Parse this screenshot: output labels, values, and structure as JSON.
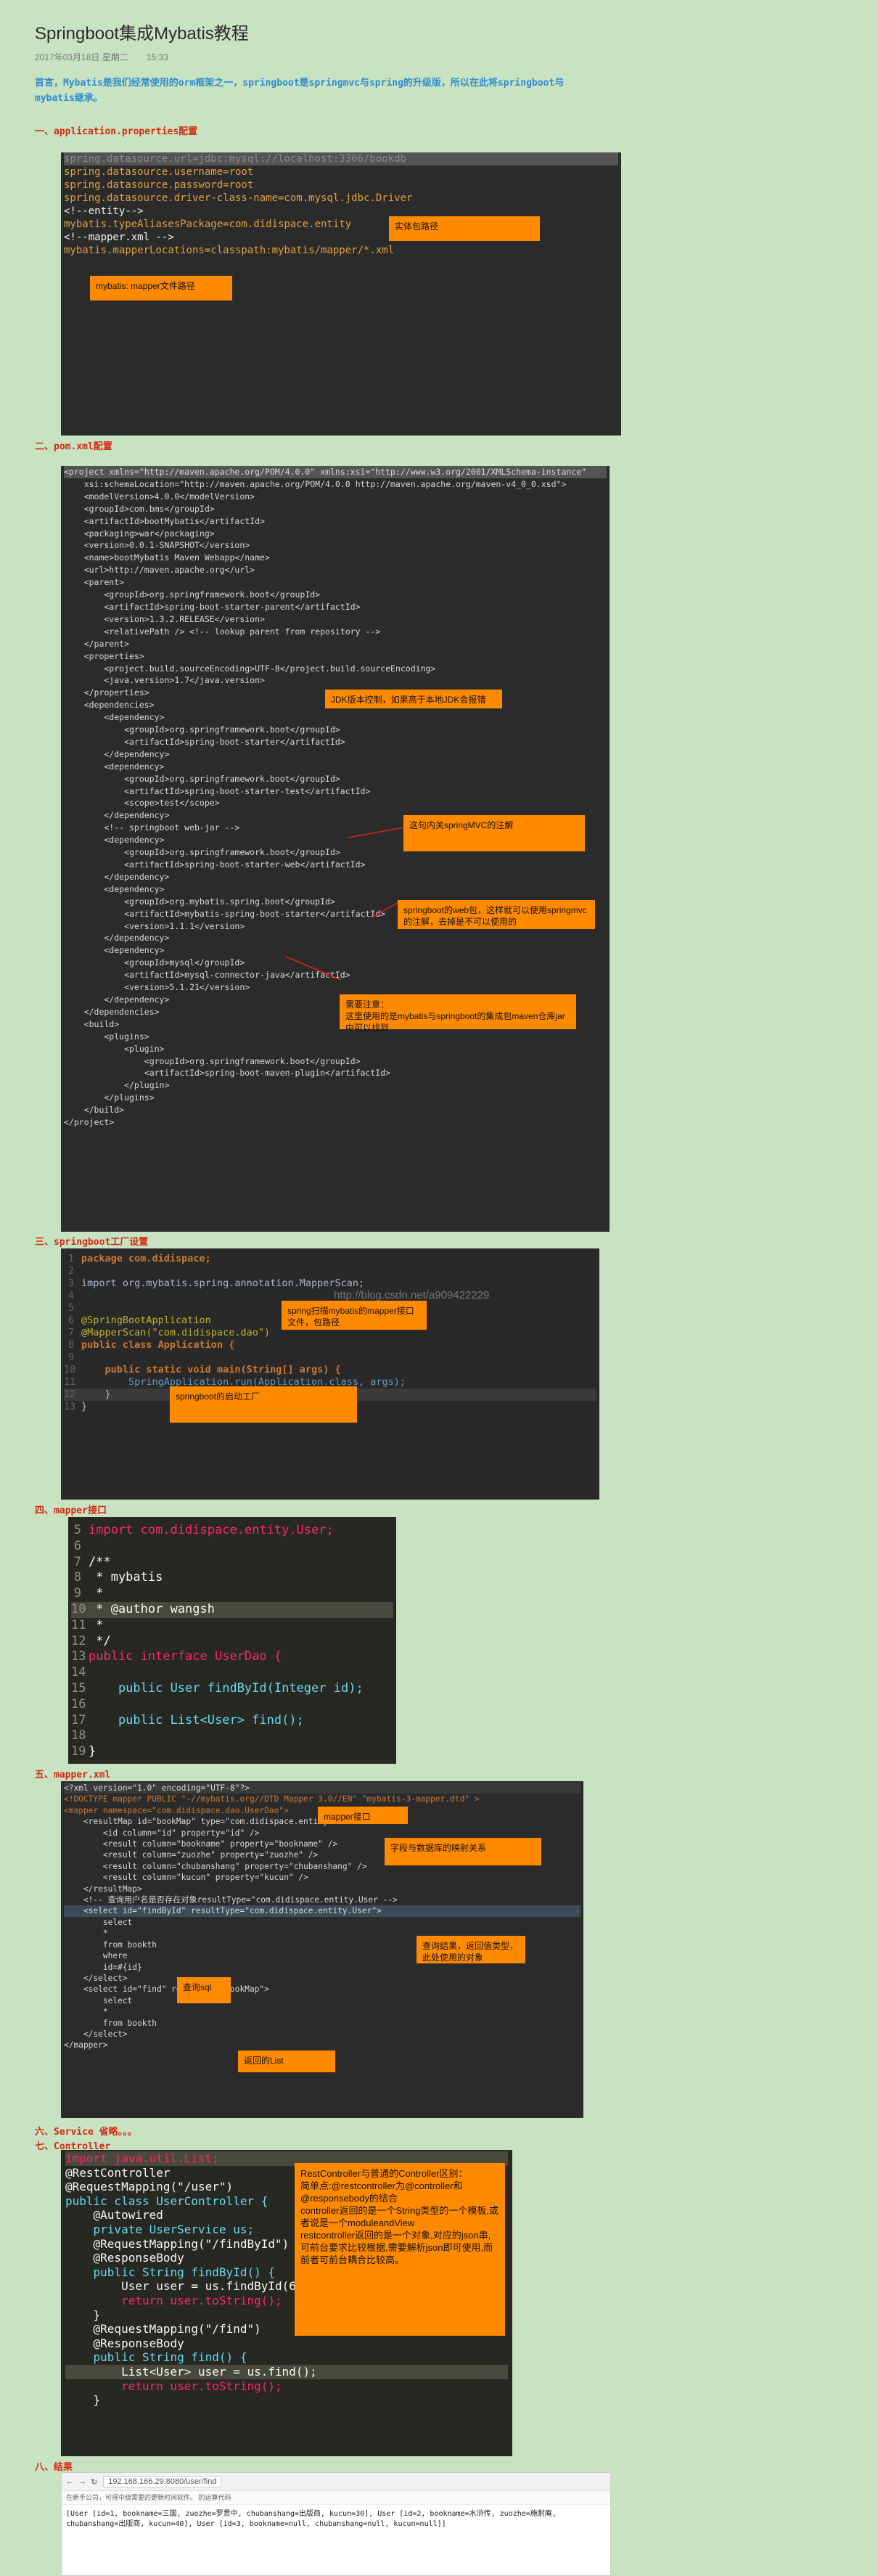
{
  "header": {
    "title": "Springboot集成Mybatis教程",
    "date": "2017年03月18日 星期二",
    "time": "15:33",
    "intro": "首言，Mybatis是我们经常使用的orm框架之一，springboot是springmvc与spring的升级版，所以在此将springboot与mybatis继承。"
  },
  "sections": {
    "s1": "一、application.properties配置",
    "s2": "二、pom.xml配置",
    "s3": "三、springboot工厂设置",
    "s4": "四、mapper接口",
    "s5": "五、mapper.xml",
    "s6": "六、Service 省略。。。",
    "s7": "七、Controller",
    "s8": "八、结果"
  },
  "props": {
    "lines": [
      "spring.datasource.url=jdbc:mysql://localhost:3306/bookdb",
      "spring.datasource.username=root",
      "spring.datasource.password=root",
      "spring.datasource.driver-class-name=com.mysql.jdbc.Driver",
      "<!--entity-->",
      "mybatis.typeAliasesPackage=com.didispace.entity",
      "<!--mapper.xml -->",
      "mybatis.mapperLocations=classpath:mybatis/mapper/*.xml"
    ],
    "note_entity": "实体包路径",
    "note_mapper": "mybatis: mapper文件路径"
  },
  "pom": {
    "lines": [
      "<project xmlns=\"http://maven.apache.org/POM/4.0.0\" xmlns:xsi=\"http://www.w3.org/2001/XMLSchema-instance\"",
      "    xsi:schemaLocation=\"http://maven.apache.org/POM/4.0.0 http://maven.apache.org/maven-v4_0_0.xsd\">",
      "    <modelVersion>4.0.0</modelVersion>",
      "    <groupId>com.bms</groupId>",
      "    <artifactId>bootMybatis</artifactId>",
      "    <packaging>war</packaging>",
      "    <version>0.0.1-SNAPSHOT</version>",
      "    <name>bootMybatis Maven Webapp</name>",
      "    <url>http://maven.apache.org</url>",
      "    <parent>",
      "        <groupId>org.springframework.boot</groupId>",
      "        <artifactId>spring-boot-starter-parent</artifactId>",
      "        <version>1.3.2.RELEASE</version>",
      "        <relativePath /> <!-- lookup parent from repository -->",
      "    </parent>",
      "",
      "    <properties>",
      "        <project.build.sourceEncoding>UTF-8</project.build.sourceEncoding>",
      "        <java.version>1.7</java.version>",
      "    </properties>",
      "",
      "    <dependencies>",
      "",
      "        <dependency>",
      "            <groupId>org.springframework.boot</groupId>",
      "            <artifactId>spring-boot-starter</artifactId>",
      "        </dependency>",
      "",
      "        <dependency>",
      "            <groupId>org.springframework.boot</groupId>",
      "            <artifactId>spring-boot-starter-test</artifactId>",
      "            <scope>test</scope>",
      "        </dependency>",
      "",
      "        <!-- springboot web-jar -->",
      "        <dependency>",
      "            <groupId>org.springframework.boot</groupId>",
      "            <artifactId>spring-boot-starter-web</artifactId>",
      "        </dependency>",
      "",
      "        <dependency>",
      "            <groupId>org.mybatis.spring.boot</groupId>",
      "            <artifactId>mybatis-spring-boot-starter</artifactId>",
      "            <version>1.1.1</version>",
      "        </dependency>",
      "        <dependency>",
      "            <groupId>mysql</groupId>",
      "            <artifactId>mysql-connector-java</artifactId>",
      "            <version>5.1.21</version>",
      "        </dependency>",
      "",
      "    </dependencies>",
      "",
      "    <build>",
      "        <plugins>",
      "            <plugin>",
      "                <groupId>org.springframework.boot</groupId>",
      "                <artifactId>spring-boot-maven-plugin</artifactId>",
      "            </plugin>",
      "        </plugins>",
      "    </build>",
      "</project>"
    ],
    "note_jdk": "JDK版本控制，如果高于本地JDK会报错",
    "note_test": "这句内关springMVC的注解",
    "note_web": "springboot的web包，这样就可以使用springmvc的注解，去掉是不可以使用的",
    "note_mybatis": "需要注意：\n这里使用的是mybatis与springboot的集成包maven仓库jar中可以找到"
  },
  "app": {
    "lines": [
      "package com.didispace;",
      "",
      "import org.mybatis.spring.annotation.MapperScan;",
      "",
      "@SpringBootApplication",
      "@MapperScan(\"com.didispace.dao\")",
      "public class Application {",
      "",
      "    public static void main(String[] args) {",
      "        SpringApplication.run(Application.class, args);",
      "    }",
      "}"
    ],
    "line_numbers": [
      "1",
      "2",
      "3",
      "4",
      "5",
      "6",
      "7",
      "8",
      "9",
      "10",
      "11",
      "12",
      "13"
    ],
    "watermark": "http://blog.csdn.net/a909422229",
    "note_scan": "spring扫描mybatis的mapper接口文件，包路径",
    "note_factory": "springboot的启动工厂"
  },
  "dao": {
    "line_numbers": [
      "5",
      "6",
      "7",
      "8",
      "9",
      "10",
      "11",
      "12",
      "13",
      "14",
      "15",
      "16",
      "17",
      "18",
      "19"
    ],
    "lines": [
      "import com.didispace.entity.User;",
      "",
      "/**",
      " * mybatis",
      " *",
      " * @author wangsh",
      " *",
      " */",
      "public interface UserDao {",
      "",
      "    public User findById(Integer id);",
      "",
      "    public List<User> find();",
      "",
      "}"
    ]
  },
  "mapperxml": {
    "lines": [
      "<?xml version=\"1.0\" encoding=\"UTF-8\"?>",
      "<!DOCTYPE mapper PUBLIC \"-//mybatis.org//DTD Mapper 3.0//EN\" \"mybatis-3-mapper.dtd\" >",
      "<mapper namespace=\"com.didispace.dao.UserDao\">",
      "",
      "    <resultMap id=\"bookMap\" type=\"com.didispace.entity.User\">",
      "        <id column=\"id\" property=\"id\" />",
      "        <result column=\"bookname\" property=\"bookname\" />",
      "        <result column=\"zuozhe\" property=\"zuozhe\" />",
      "        <result column=\"chubanshang\" property=\"chubanshang\" />",
      "        <result column=\"kucun\" property=\"kucun\" />",
      "    </resultMap>",
      "",
      "    <!-- 查询用户名是否存在对象resultType=\"com.didispace.entity.User -->",
      "",
      "    <select id=\"findById\" resultType=\"com.didispace.entity.User\">",
      "        select",
      "        *",
      "        from bookth",
      "        where",
      "        id=#{id}",
      "    </select>",
      "",
      "    <select id=\"find\" resultMap=\"bookMap\">",
      "        select",
      "        *",
      "        from bookth",
      "    </select>",
      "",
      "</mapper>"
    ],
    "note_iface": "mapper接口",
    "note_fields": "字段与数据库的映射关系",
    "note_result": "查询结果，返回值类型，此处使用的对象",
    "note_sql": "查询sql",
    "note_list": "返回的List"
  },
  "controller": {
    "lines": [
      "import java.util.List;",
      "",
      "@RestController",
      "@RequestMapping(\"/user\")",
      "public class UserController {",
      "    @Autowired",
      "    private UserService us;",
      "",
      "    @RequestMapping(\"/findById\")",
      "    @ResponseBody",
      "    public String findById() {",
      "        User user = us.findById(6);",
      "        return user.toString();",
      "    }",
      "",
      "    @RequestMapping(\"/find\")",
      "    @ResponseBody",
      "    public String find() {",
      "        List<User> user = us.find();",
      "        return user.toString();",
      "    }"
    ],
    "note": "RestController与普通的Controller区别：\n简单点:@restcontroller为@controller和@responsebody的结合\ncontroller返回的是一个String类型的一个模板,或者说是一个moduleandView\nrestcontroller返回的是一个对象,对应的json串,可前台要求比较根据,需要解析json即可使用,而前者可前台耦合比较高。"
  },
  "result": {
    "url": "192.168.166.29:8080/user/find",
    "bookmarks": "在新手公司，可得中级需要的更新时间软件。 的运算代码",
    "output": "[User [id=1, bookname=三国, zuozhe=罗贯中, chubanshang=出版商, kucun=30], User [id=2, bookname=水浒传, zuozhe=施耐庵, chubanshang=出版商, kucun=40], User [id=3, bookname=null, chubanshang=null, kucun=null]]"
  }
}
